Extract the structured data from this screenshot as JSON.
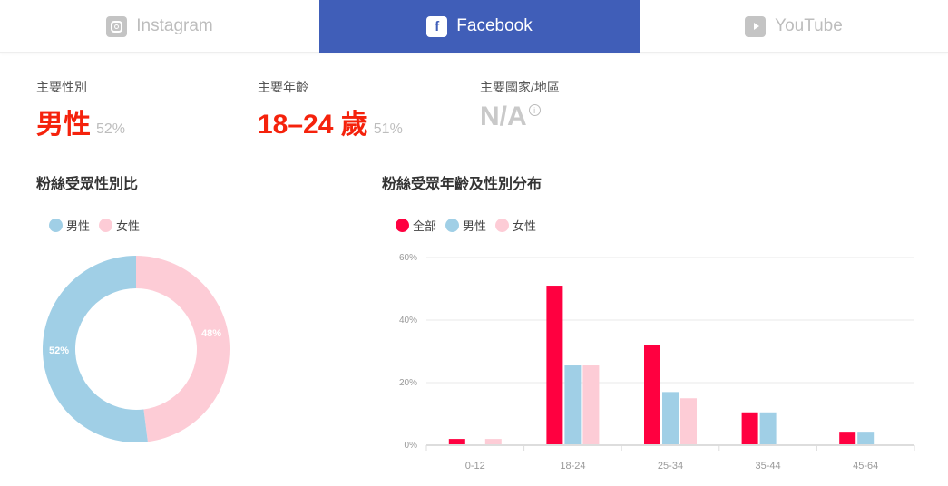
{
  "tabs": [
    {
      "label": "Instagram",
      "icon": "instagram-icon",
      "active": false
    },
    {
      "label": "Facebook",
      "icon": "facebook-icon",
      "active": true
    },
    {
      "label": "YouTube",
      "icon": "youtube-icon",
      "active": false
    }
  ],
  "stats": {
    "gender": {
      "label": "主要性別",
      "value": "男性",
      "pct": "52%"
    },
    "age": {
      "label": "主要年齡",
      "value": "18–24 歲",
      "pct": "51%"
    },
    "country": {
      "label": "主要國家/地區",
      "value": "N/A",
      "info": "i"
    }
  },
  "colors": {
    "all": "#ff0040",
    "male": "#a0cfe6",
    "female": "#fdccd6",
    "accent": "#405eb8",
    "highlight": "#f5220c"
  },
  "chart_data": [
    {
      "type": "pie",
      "title": "粉絲受眾性別比",
      "legend": [
        "男性",
        "女性"
      ],
      "legend_position": "top-left",
      "donut": true,
      "slices": [
        {
          "label": "男性",
          "value": 52,
          "text": "52%"
        },
        {
          "label": "女性",
          "value": 48,
          "text": "48%"
        }
      ]
    },
    {
      "type": "bar",
      "title": "粉絲受眾年齡及性別分布",
      "legend": [
        "全部",
        "男性",
        "女性"
      ],
      "legend_position": "top-left",
      "categories": [
        "0-12",
        "18-24",
        "25-34",
        "35-44",
        "45-64"
      ],
      "series": [
        {
          "name": "全部",
          "values": [
            2,
            51,
            32,
            10.5,
            4.3
          ]
        },
        {
          "name": "男性",
          "values": [
            0,
            25.5,
            17,
            10.5,
            4.3
          ]
        },
        {
          "name": "女性",
          "values": [
            2,
            25.5,
            15,
            0,
            0
          ]
        }
      ],
      "yticks": [
        "0%",
        "20%",
        "40%",
        "60%"
      ],
      "ylim": [
        0,
        60
      ],
      "grid": true,
      "xlabel": "",
      "ylabel": ""
    }
  ]
}
